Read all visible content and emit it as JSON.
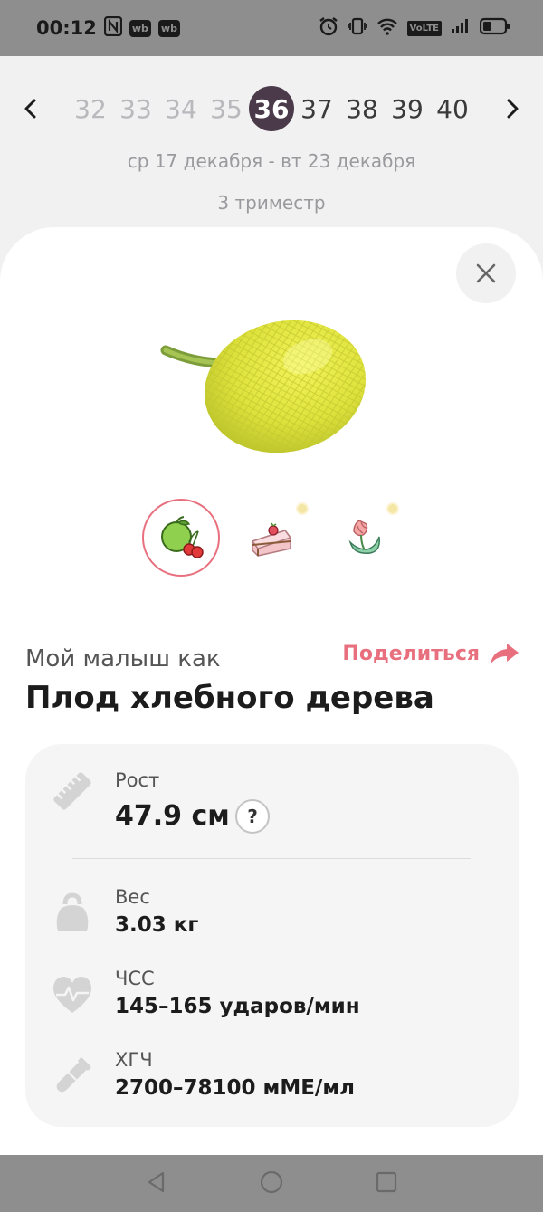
{
  "status_bar": {
    "time": "00:12",
    "badges": [
      "wb",
      "wb"
    ],
    "network": "VoLTE"
  },
  "weeks": {
    "items": [
      "32",
      "33",
      "34",
      "35",
      "36",
      "37",
      "38",
      "39",
      "40"
    ],
    "active": "36",
    "date_range": "ср 17 декабря - вт 23 декабря",
    "trimester": "3 триместр"
  },
  "fruit": {
    "caption": "Мой малыш как",
    "share_label": "Поделиться",
    "name": "Плод хлебного дерева",
    "variants": [
      {
        "icon": "fruit-icon",
        "selected": true
      },
      {
        "icon": "cake-icon",
        "selected": false
      },
      {
        "icon": "flower-icon",
        "selected": false
      }
    ]
  },
  "stats": {
    "height": {
      "label": "Рост",
      "value": "47.9 см",
      "help": "?"
    },
    "weight": {
      "label": "Вес",
      "value": "3.03 кг"
    },
    "heart_rate": {
      "label": "ЧСС",
      "value": "145–165 ударов/мин"
    },
    "hcg": {
      "label": "ХГЧ",
      "value": "2700–78100 мМЕ/мл"
    }
  },
  "colors": {
    "accent": "#e8707e",
    "active_week": "#4a3a4a",
    "card_bg": "#f5f5f5"
  }
}
